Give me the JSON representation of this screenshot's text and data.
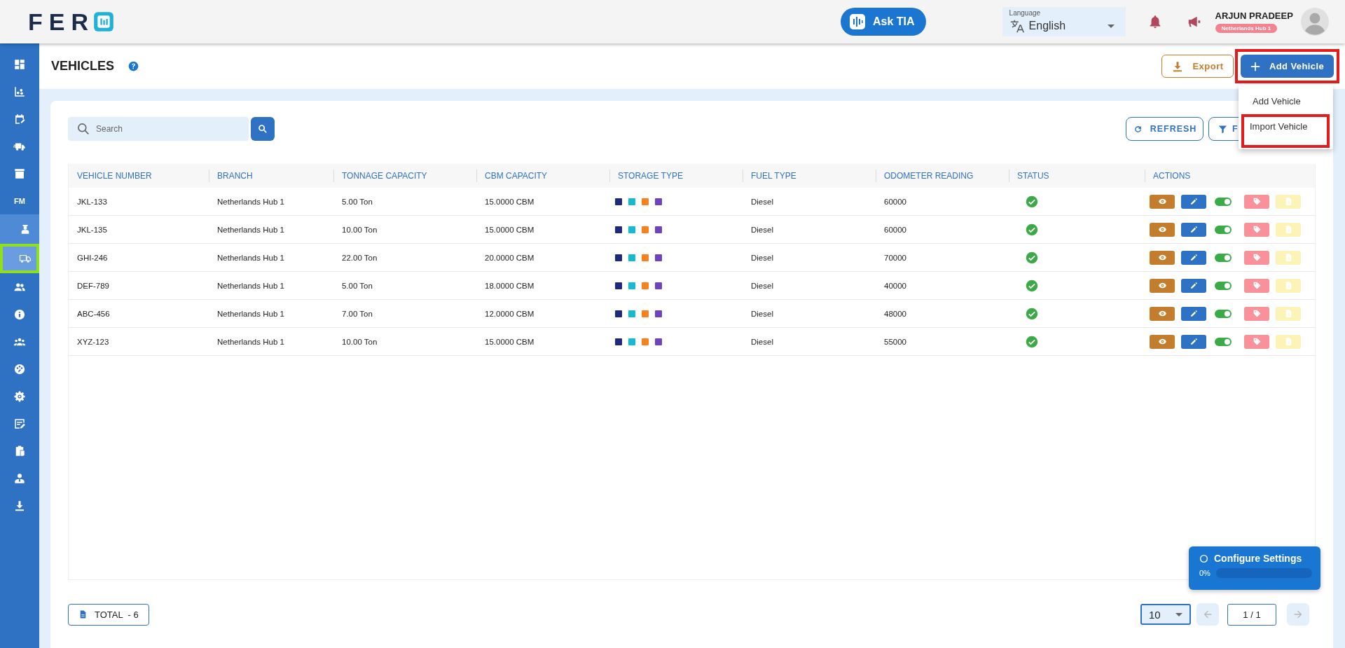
{
  "header": {
    "logo": "FER",
    "ask_button": "Ask TIA",
    "language": {
      "label": "Language",
      "value": "English"
    },
    "user": {
      "name": "ARJUN PRADEEP",
      "branch": "Netherlands Hub 1"
    }
  },
  "sidebar": {
    "items": [
      {
        "kind": "dashboard",
        "selected": false
      },
      {
        "kind": "chart",
        "selected": false
      },
      {
        "kind": "calendar",
        "selected": false
      },
      {
        "kind": "truck",
        "selected": false
      },
      {
        "kind": "archive",
        "selected": false
      },
      {
        "kind": "text",
        "label": "FM",
        "selected": false,
        "children": [
          {
            "kind": "driver",
            "selected": false,
            "highlighted": false
          },
          {
            "kind": "vehicle",
            "selected": true,
            "highlighted": true
          }
        ]
      },
      {
        "kind": "users",
        "selected": false
      },
      {
        "kind": "info",
        "selected": false
      },
      {
        "kind": "team",
        "selected": false
      },
      {
        "kind": "palette",
        "selected": false
      },
      {
        "kind": "settings",
        "selected": false
      },
      {
        "kind": "form",
        "selected": false
      },
      {
        "kind": "clipboard",
        "selected": false
      },
      {
        "kind": "manager",
        "selected": false
      },
      {
        "kind": "download",
        "selected": false
      }
    ]
  },
  "page": {
    "title": "VEHICLES",
    "export_button": "Export",
    "add_button": {
      "label": "Add Vehicle",
      "highlighted": true
    },
    "add_menu": [
      {
        "label": "Add Vehicle",
        "highlighted": false
      },
      {
        "label": "Import Vehicle",
        "highlighted": true
      }
    ]
  },
  "toolbar": {
    "search": {
      "placeholder": "Search"
    },
    "refresh_button": "REFRESH",
    "filter_button": "F"
  },
  "table": {
    "columns": [
      "VEHICLE NUMBER",
      "BRANCH",
      "TONNAGE CAPACITY",
      "CBM CAPACITY",
      "STORAGE TYPE",
      "FUEL TYPE",
      "ODOMETER READING",
      "STATUS",
      "ACTIONS"
    ],
    "rows": [
      {
        "vehicle_number": "JKL-133",
        "branch": "Netherlands Hub 1",
        "tonnage": "5.00 Ton",
        "cbm": "15.0000 CBM",
        "storage_types": [
          {
            "color": "#1f2a7c"
          },
          {
            "color": "#13bcd4"
          },
          {
            "color": "#f5821f"
          },
          {
            "color": "#6f42c1"
          }
        ],
        "fuel_type": "Diesel",
        "odometer": "60000",
        "active": true,
        "enabled": true
      },
      {
        "vehicle_number": "JKL-135",
        "branch": "Netherlands Hub 1",
        "tonnage": "10.00 Ton",
        "cbm": "15.0000 CBM",
        "storage_types": [
          {
            "color": "#1f2a7c"
          },
          {
            "color": "#13bcd4"
          },
          {
            "color": "#f5821f"
          },
          {
            "color": "#6f42c1"
          }
        ],
        "fuel_type": "Diesel",
        "odometer": "60000",
        "active": true,
        "enabled": true
      },
      {
        "vehicle_number": "GHI-246",
        "branch": "Netherlands Hub 1",
        "tonnage": "22.00 Ton",
        "cbm": "20.0000 CBM",
        "storage_types": [
          {
            "color": "#1f2a7c"
          },
          {
            "color": "#13bcd4"
          },
          {
            "color": "#f5821f"
          },
          {
            "color": "#6f42c1"
          }
        ],
        "fuel_type": "Diesel",
        "odometer": "70000",
        "active": true,
        "enabled": true
      },
      {
        "vehicle_number": "DEF-789",
        "branch": "Netherlands Hub 1",
        "tonnage": "5.00 Ton",
        "cbm": "18.0000 CBM",
        "storage_types": [
          {
            "color": "#1f2a7c"
          },
          {
            "color": "#13bcd4"
          },
          {
            "color": "#f5821f"
          },
          {
            "color": "#6f42c1"
          }
        ],
        "fuel_type": "Diesel",
        "odometer": "40000",
        "active": true,
        "enabled": true
      },
      {
        "vehicle_number": "ABC-456",
        "branch": "Netherlands Hub 1",
        "tonnage": "7.00 Ton",
        "cbm": "12.0000 CBM",
        "storage_types": [
          {
            "color": "#1f2a7c"
          },
          {
            "color": "#13bcd4"
          },
          {
            "color": "#f5821f"
          },
          {
            "color": "#6f42c1"
          }
        ],
        "fuel_type": "Diesel",
        "odometer": "48000",
        "active": true,
        "enabled": true
      },
      {
        "vehicle_number": "XYZ-123",
        "branch": "Netherlands Hub 1",
        "tonnage": "10.00 Ton",
        "cbm": "15.0000 CBM",
        "storage_types": [
          {
            "color": "#1f2a7c"
          },
          {
            "color": "#13bcd4"
          },
          {
            "color": "#f5821f"
          },
          {
            "color": "#6f42c1"
          }
        ],
        "fuel_type": "Diesel",
        "odometer": "55000",
        "active": true,
        "enabled": true
      }
    ]
  },
  "footer": {
    "total": "TOTAL  - 6",
    "page_size": "10",
    "page": "1 / 1",
    "prev_disabled": true,
    "next_disabled": true
  },
  "setup_widget": {
    "title": "Configure Settings",
    "reading": "0%",
    "level": 0
  }
}
